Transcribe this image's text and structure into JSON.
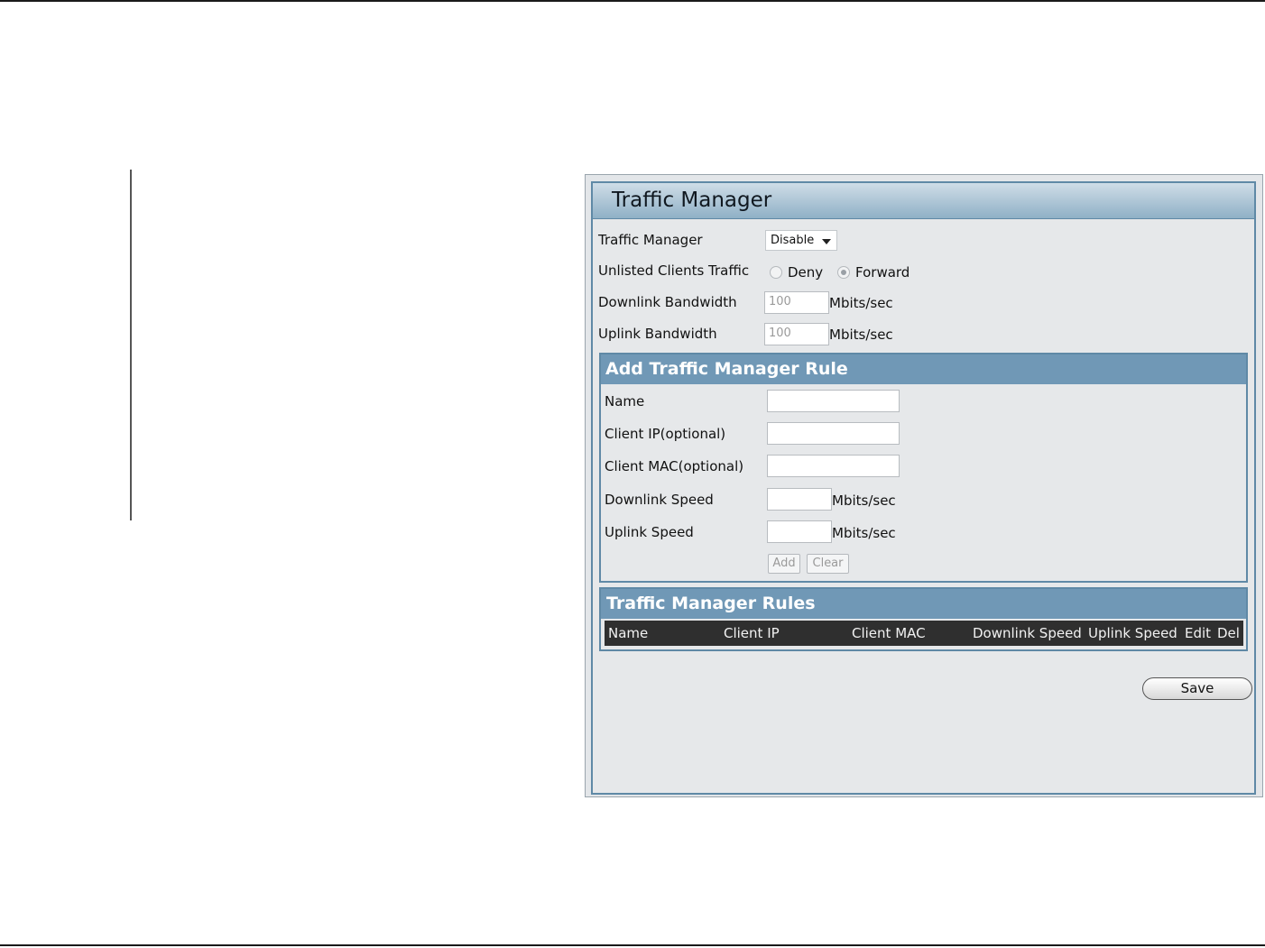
{
  "panel": {
    "title": "Traffic Manager"
  },
  "settings": {
    "traffic_manager_label": "Traffic Manager",
    "traffic_manager_value": "Disable",
    "unlisted_label": "Unlisted Clients Traffic",
    "deny_label": "Deny",
    "forward_label": "Forward",
    "downlink_label": "Downlink Bandwidth",
    "downlink_value": "100",
    "uplink_label": "Uplink Bandwidth",
    "uplink_value": "100",
    "unit": "Mbits/sec"
  },
  "add_rule": {
    "title": "Add Traffic Manager Rule",
    "name_label": "Name",
    "client_ip_label": "Client IP(optional)",
    "client_mac_label": "Client MAC(optional)",
    "downlink_speed_label": "Downlink Speed",
    "uplink_speed_label": "Uplink Speed",
    "unit": "Mbits/sec",
    "add_button": "Add",
    "clear_button": "Clear"
  },
  "rules": {
    "title": "Traffic Manager Rules",
    "columns": [
      "Name",
      "Client IP",
      "Client MAC",
      "Downlink Speed",
      "Uplink Speed",
      "Edit",
      "Del"
    ]
  },
  "save_button": "Save"
}
